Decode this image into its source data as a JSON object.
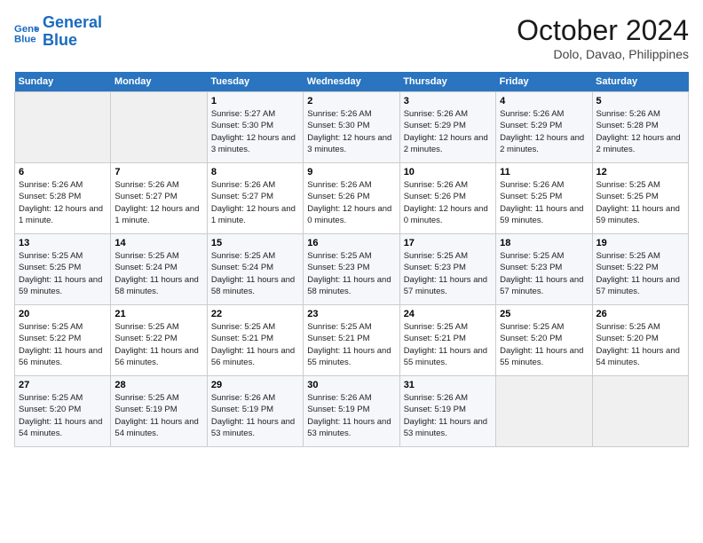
{
  "header": {
    "logo_line1": "General",
    "logo_line2": "Blue",
    "month": "October 2024",
    "location": "Dolo, Davao, Philippines"
  },
  "weekdays": [
    "Sunday",
    "Monday",
    "Tuesday",
    "Wednesday",
    "Thursday",
    "Friday",
    "Saturday"
  ],
  "weeks": [
    [
      {
        "day": "",
        "sunrise": "",
        "sunset": "",
        "daylight": ""
      },
      {
        "day": "",
        "sunrise": "",
        "sunset": "",
        "daylight": ""
      },
      {
        "day": "1",
        "sunrise": "Sunrise: 5:27 AM",
        "sunset": "Sunset: 5:30 PM",
        "daylight": "Daylight: 12 hours and 3 minutes."
      },
      {
        "day": "2",
        "sunrise": "Sunrise: 5:26 AM",
        "sunset": "Sunset: 5:30 PM",
        "daylight": "Daylight: 12 hours and 3 minutes."
      },
      {
        "day": "3",
        "sunrise": "Sunrise: 5:26 AM",
        "sunset": "Sunset: 5:29 PM",
        "daylight": "Daylight: 12 hours and 2 minutes."
      },
      {
        "day": "4",
        "sunrise": "Sunrise: 5:26 AM",
        "sunset": "Sunset: 5:29 PM",
        "daylight": "Daylight: 12 hours and 2 minutes."
      },
      {
        "day": "5",
        "sunrise": "Sunrise: 5:26 AM",
        "sunset": "Sunset: 5:28 PM",
        "daylight": "Daylight: 12 hours and 2 minutes."
      }
    ],
    [
      {
        "day": "6",
        "sunrise": "Sunrise: 5:26 AM",
        "sunset": "Sunset: 5:28 PM",
        "daylight": "Daylight: 12 hours and 1 minute."
      },
      {
        "day": "7",
        "sunrise": "Sunrise: 5:26 AM",
        "sunset": "Sunset: 5:27 PM",
        "daylight": "Daylight: 12 hours and 1 minute."
      },
      {
        "day": "8",
        "sunrise": "Sunrise: 5:26 AM",
        "sunset": "Sunset: 5:27 PM",
        "daylight": "Daylight: 12 hours and 1 minute."
      },
      {
        "day": "9",
        "sunrise": "Sunrise: 5:26 AM",
        "sunset": "Sunset: 5:26 PM",
        "daylight": "Daylight: 12 hours and 0 minutes."
      },
      {
        "day": "10",
        "sunrise": "Sunrise: 5:26 AM",
        "sunset": "Sunset: 5:26 PM",
        "daylight": "Daylight: 12 hours and 0 minutes."
      },
      {
        "day": "11",
        "sunrise": "Sunrise: 5:26 AM",
        "sunset": "Sunset: 5:25 PM",
        "daylight": "Daylight: 11 hours and 59 minutes."
      },
      {
        "day": "12",
        "sunrise": "Sunrise: 5:25 AM",
        "sunset": "Sunset: 5:25 PM",
        "daylight": "Daylight: 11 hours and 59 minutes."
      }
    ],
    [
      {
        "day": "13",
        "sunrise": "Sunrise: 5:25 AM",
        "sunset": "Sunset: 5:25 PM",
        "daylight": "Daylight: 11 hours and 59 minutes."
      },
      {
        "day": "14",
        "sunrise": "Sunrise: 5:25 AM",
        "sunset": "Sunset: 5:24 PM",
        "daylight": "Daylight: 11 hours and 58 minutes."
      },
      {
        "day": "15",
        "sunrise": "Sunrise: 5:25 AM",
        "sunset": "Sunset: 5:24 PM",
        "daylight": "Daylight: 11 hours and 58 minutes."
      },
      {
        "day": "16",
        "sunrise": "Sunrise: 5:25 AM",
        "sunset": "Sunset: 5:23 PM",
        "daylight": "Daylight: 11 hours and 58 minutes."
      },
      {
        "day": "17",
        "sunrise": "Sunrise: 5:25 AM",
        "sunset": "Sunset: 5:23 PM",
        "daylight": "Daylight: 11 hours and 57 minutes."
      },
      {
        "day": "18",
        "sunrise": "Sunrise: 5:25 AM",
        "sunset": "Sunset: 5:23 PM",
        "daylight": "Daylight: 11 hours and 57 minutes."
      },
      {
        "day": "19",
        "sunrise": "Sunrise: 5:25 AM",
        "sunset": "Sunset: 5:22 PM",
        "daylight": "Daylight: 11 hours and 57 minutes."
      }
    ],
    [
      {
        "day": "20",
        "sunrise": "Sunrise: 5:25 AM",
        "sunset": "Sunset: 5:22 PM",
        "daylight": "Daylight: 11 hours and 56 minutes."
      },
      {
        "day": "21",
        "sunrise": "Sunrise: 5:25 AM",
        "sunset": "Sunset: 5:22 PM",
        "daylight": "Daylight: 11 hours and 56 minutes."
      },
      {
        "day": "22",
        "sunrise": "Sunrise: 5:25 AM",
        "sunset": "Sunset: 5:21 PM",
        "daylight": "Daylight: 11 hours and 56 minutes."
      },
      {
        "day": "23",
        "sunrise": "Sunrise: 5:25 AM",
        "sunset": "Sunset: 5:21 PM",
        "daylight": "Daylight: 11 hours and 55 minutes."
      },
      {
        "day": "24",
        "sunrise": "Sunrise: 5:25 AM",
        "sunset": "Sunset: 5:21 PM",
        "daylight": "Daylight: 11 hours and 55 minutes."
      },
      {
        "day": "25",
        "sunrise": "Sunrise: 5:25 AM",
        "sunset": "Sunset: 5:20 PM",
        "daylight": "Daylight: 11 hours and 55 minutes."
      },
      {
        "day": "26",
        "sunrise": "Sunrise: 5:25 AM",
        "sunset": "Sunset: 5:20 PM",
        "daylight": "Daylight: 11 hours and 54 minutes."
      }
    ],
    [
      {
        "day": "27",
        "sunrise": "Sunrise: 5:25 AM",
        "sunset": "Sunset: 5:20 PM",
        "daylight": "Daylight: 11 hours and 54 minutes."
      },
      {
        "day": "28",
        "sunrise": "Sunrise: 5:25 AM",
        "sunset": "Sunset: 5:19 PM",
        "daylight": "Daylight: 11 hours and 54 minutes."
      },
      {
        "day": "29",
        "sunrise": "Sunrise: 5:26 AM",
        "sunset": "Sunset: 5:19 PM",
        "daylight": "Daylight: 11 hours and 53 minutes."
      },
      {
        "day": "30",
        "sunrise": "Sunrise: 5:26 AM",
        "sunset": "Sunset: 5:19 PM",
        "daylight": "Daylight: 11 hours and 53 minutes."
      },
      {
        "day": "31",
        "sunrise": "Sunrise: 5:26 AM",
        "sunset": "Sunset: 5:19 PM",
        "daylight": "Daylight: 11 hours and 53 minutes."
      },
      {
        "day": "",
        "sunrise": "",
        "sunset": "",
        "daylight": ""
      },
      {
        "day": "",
        "sunrise": "",
        "sunset": "",
        "daylight": ""
      }
    ]
  ]
}
